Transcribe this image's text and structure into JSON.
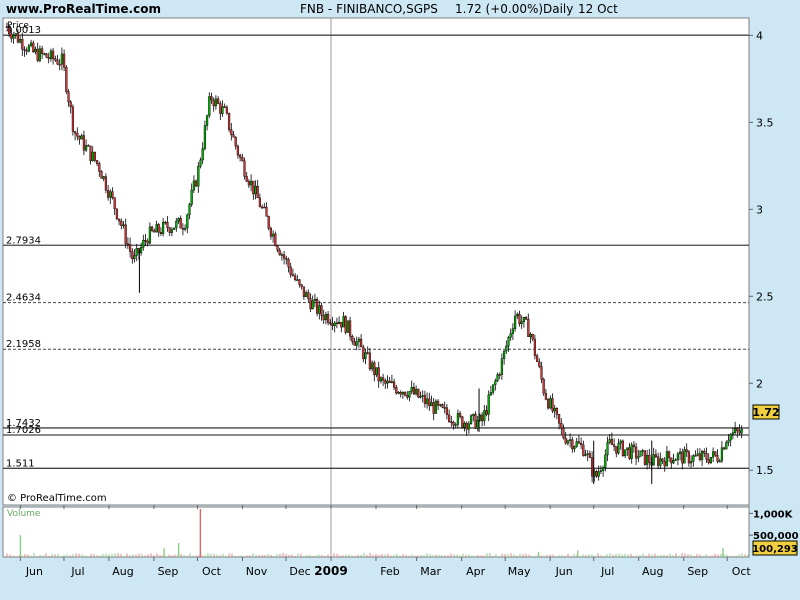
{
  "header": {
    "site": "www.ProRealTime.com",
    "symbol": "FNB - FINIBANCO,SGPS",
    "quote": "1.72 (+0.00%)",
    "period": "Daily",
    "date": "12 Oct"
  },
  "colors": {
    "background": "#cde7f4",
    "panel": "#ffffff",
    "up_candle": "#00aa00",
    "down_candle": "#cc3333",
    "volume_bars": "#88cc88",
    "last_price_box": "#f0d040"
  },
  "chart_data": [
    {
      "type": "candlestick",
      "title": "",
      "panel_label": "Price",
      "copyright": "© ProRealTime.com",
      "last_price_label": "1.72",
      "y_ticks": [
        "4",
        "3.5",
        "3",
        "2.5",
        "2",
        "1.5"
      ],
      "y_tick_values": [
        4,
        3.5,
        3,
        2.5,
        2,
        1.5
      ],
      "ylim": [
        1.3,
        4.1
      ],
      "x_tick_labels": [
        "Jun",
        "Jul",
        "Aug",
        "Sep",
        "Oct",
        "Nov",
        "Dec",
        "2009",
        "Feb",
        "Mar",
        "Apr",
        "May",
        "Jun",
        "Jul",
        "Aug",
        "Sep",
        "Oct"
      ],
      "year_separator": "2009",
      "horizontal_levels": [
        {
          "label": "4.0013",
          "value": 4.0013,
          "style": "solid"
        },
        {
          "label": "2.7934",
          "value": 2.7934,
          "style": "solid"
        },
        {
          "label": "2.4634",
          "value": 2.4634,
          "style": "dashed"
        },
        {
          "label": "2.1958",
          "value": 2.1958,
          "style": "dashed"
        },
        {
          "label": "1.7432",
          "value": 1.7432,
          "style": "solid"
        },
        {
          "label": "1.7026",
          "value": 1.7026,
          "style": "solid"
        },
        {
          "label": "1.511",
          "value": 1.511,
          "style": "solid"
        }
      ],
      "price_path": [
        [
          "2008-05-22",
          4.05
        ],
        [
          "2008-06-10",
          3.9
        ],
        [
          "2008-06-30",
          3.85
        ],
        [
          "2008-07-08",
          3.45
        ],
        [
          "2008-07-25",
          3.25
        ],
        [
          "2008-08-08",
          2.95
        ],
        [
          "2008-08-18",
          2.7
        ],
        [
          "2008-08-28",
          2.85
        ],
        [
          "2008-09-10",
          2.9
        ],
        [
          "2008-09-22",
          2.92
        ],
        [
          "2008-10-01",
          3.2
        ],
        [
          "2008-10-10",
          3.65
        ],
        [
          "2008-10-20",
          3.55
        ],
        [
          "2008-10-30",
          3.3
        ],
        [
          "2008-11-12",
          3.05
        ],
        [
          "2008-11-25",
          2.8
        ],
        [
          "2008-12-10",
          2.55
        ],
        [
          "2008-12-25",
          2.4
        ],
        [
          "2009-01-10",
          2.35
        ],
        [
          "2009-01-25",
          2.15
        ],
        [
          "2009-02-05",
          2.0
        ],
        [
          "2009-02-25",
          1.95
        ],
        [
          "2009-03-15",
          1.85
        ],
        [
          "2009-04-01",
          1.78
        ],
        [
          "2009-04-15",
          1.78
        ],
        [
          "2009-04-28",
          2.1
        ],
        [
          "2009-05-08",
          2.4
        ],
        [
          "2009-05-18",
          2.3
        ],
        [
          "2009-05-28",
          1.95
        ],
        [
          "2009-06-10",
          1.7
        ],
        [
          "2009-06-25",
          1.62
        ],
        [
          "2009-07-02",
          1.45
        ],
        [
          "2009-07-12",
          1.65
        ],
        [
          "2009-07-28",
          1.6
        ],
        [
          "2009-08-10",
          1.55
        ],
        [
          "2009-08-25",
          1.58
        ],
        [
          "2009-09-10",
          1.57
        ],
        [
          "2009-09-25",
          1.58
        ],
        [
          "2009-10-01",
          1.7
        ],
        [
          "2009-10-12",
          1.72
        ]
      ],
      "spikes": [
        {
          "date": "2008-08-22",
          "low": 2.52
        },
        {
          "date": "2009-04-13",
          "low": 1.72
        },
        {
          "date": "2009-07-01",
          "low": 1.42
        },
        {
          "date": "2009-08-10",
          "low": 1.42
        }
      ]
    },
    {
      "type": "bar",
      "panel_label": "Volume",
      "y_ticks": [
        "1,000K",
        "500,000"
      ],
      "y_tick_values": [
        1000000,
        500000
      ],
      "last_value_label": "100,293",
      "spikes": [
        {
          "date": "2008-06-01",
          "value": 500000
        },
        {
          "date": "2008-09-08",
          "value": 200000
        },
        {
          "date": "2008-09-18",
          "value": 320000
        },
        {
          "date": "2008-10-03",
          "value": 1100000
        },
        {
          "date": "2009-05-24",
          "value": 120000
        },
        {
          "date": "2009-06-20",
          "value": 150000
        },
        {
          "date": "2009-09-28",
          "value": 200000
        }
      ]
    }
  ]
}
